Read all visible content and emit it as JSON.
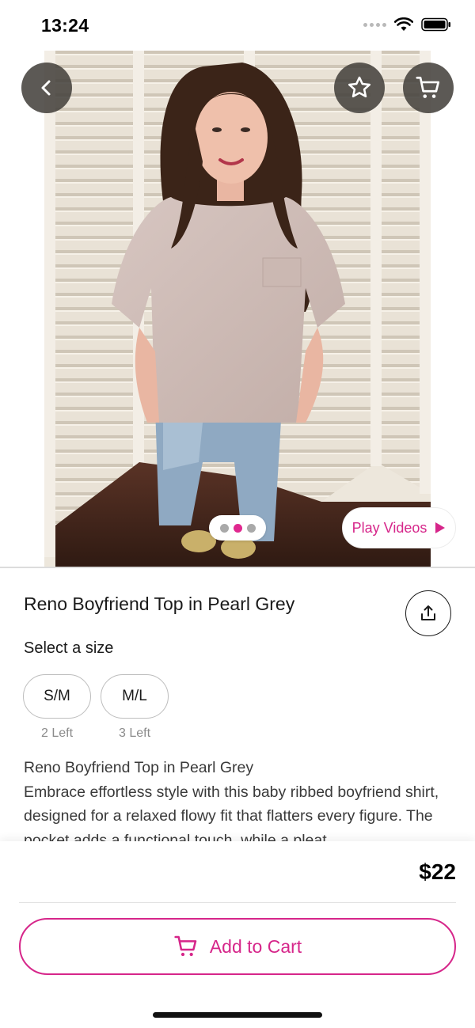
{
  "status_bar": {
    "time": "13:24"
  },
  "hero": {
    "back_icon": "chevron-left-icon",
    "favorite_icon": "star-icon",
    "cart_icon": "cart-icon",
    "pager": {
      "count": 3,
      "active_index": 1
    },
    "play_videos_label": "Play Videos",
    "play_icon": "play-icon"
  },
  "product": {
    "title": "Reno Boyfriend Top in Pearl Grey",
    "share_icon": "share-icon",
    "size_label": "Select a size",
    "sizes": [
      {
        "label": "S/M",
        "stock": "2 Left"
      },
      {
        "label": "M/L",
        "stock": "3 Left"
      }
    ],
    "description_title": "Reno Boyfriend Top in Pearl Grey",
    "description": "Embrace effortless style with this baby ribbed boyfriend shirt, designed for a relaxed flowy fit that flatters every figure. The pocket adds a functional touch, while a pleat"
  },
  "bottom_bar": {
    "price": "$22",
    "add_to_cart_label": "Add to Cart"
  },
  "colors": {
    "accent": "#d6268a",
    "overlay_button": "#46423e"
  }
}
